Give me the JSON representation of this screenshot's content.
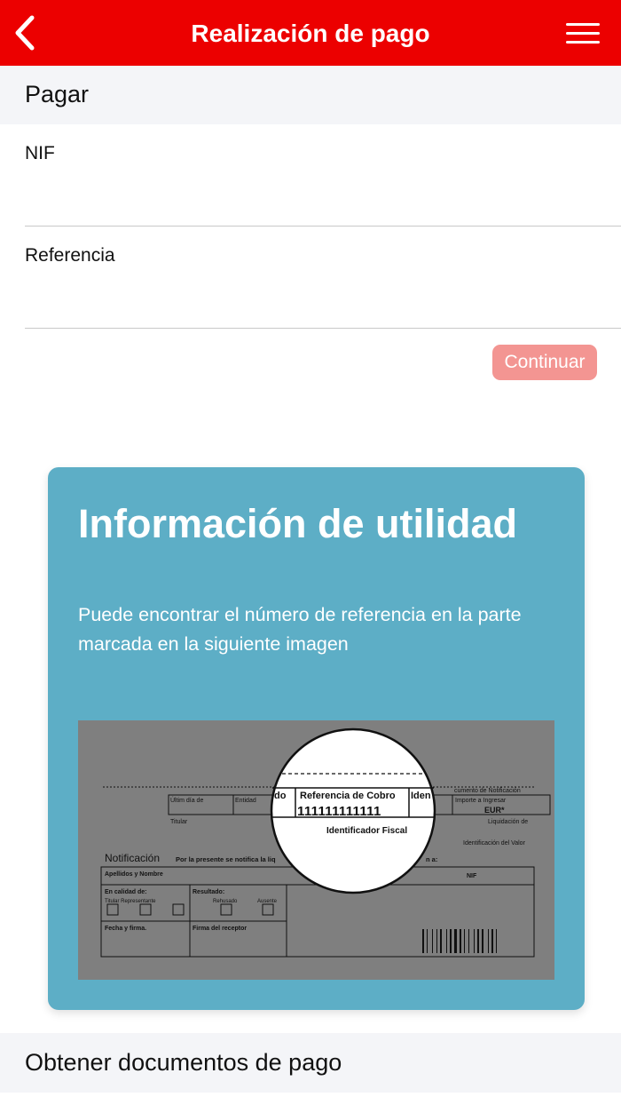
{
  "header": {
    "title": "Realización de pago",
    "back_icon": "chevron-left-icon",
    "menu_icon": "hamburger-menu-icon",
    "bar_color": "#ec0000"
  },
  "pay_section": {
    "title": "Pagar"
  },
  "form": {
    "nif": {
      "label": "NIF",
      "value": ""
    },
    "reference": {
      "label": "Referencia",
      "value": ""
    },
    "continue_label": "Continuar",
    "continue_color": "#f39592"
  },
  "info_card": {
    "title": "Información de utilidad",
    "text": "Puede encontrar el número de referencia en la parte marcada en la siguiente imagen",
    "background": "#5daec6",
    "document": {
      "lens_left_fragment": "do",
      "reference_label": "Referencia de Cobro",
      "reference_number": "111111111111",
      "lens_right_fragment": "Iden",
      "fiscal_label": "Identificador Fiscal",
      "last_day_label": "Últim día de",
      "entity_label": "Entidad",
      "notif_doc_label": "cumento de Notificación",
      "amount_label": "Importe a Ingresar",
      "currency_label": "EUR*",
      "holder_label": "Titular",
      "liquidation_label": "Liquidación de",
      "value_id_label": "Identificación del Valor",
      "notification_title": "Notificación",
      "notification_text": "Por la presente se notifica la liq",
      "notification_text_end": "n a:",
      "names_label": "Apellidos y Nombre",
      "nif_label": "NIF",
      "capacity_label": "En calidad de:",
      "holder_rep_label": "Titular Representante",
      "result_label": "Resultado:",
      "refused_label": "Rehusado",
      "absent_label": "Ausente",
      "date_sign_label": "Fecha y firma.",
      "receiver_sign_label": "Firma del receptor"
    }
  },
  "docs_section": {
    "title": "Obtener documentos de pago"
  }
}
